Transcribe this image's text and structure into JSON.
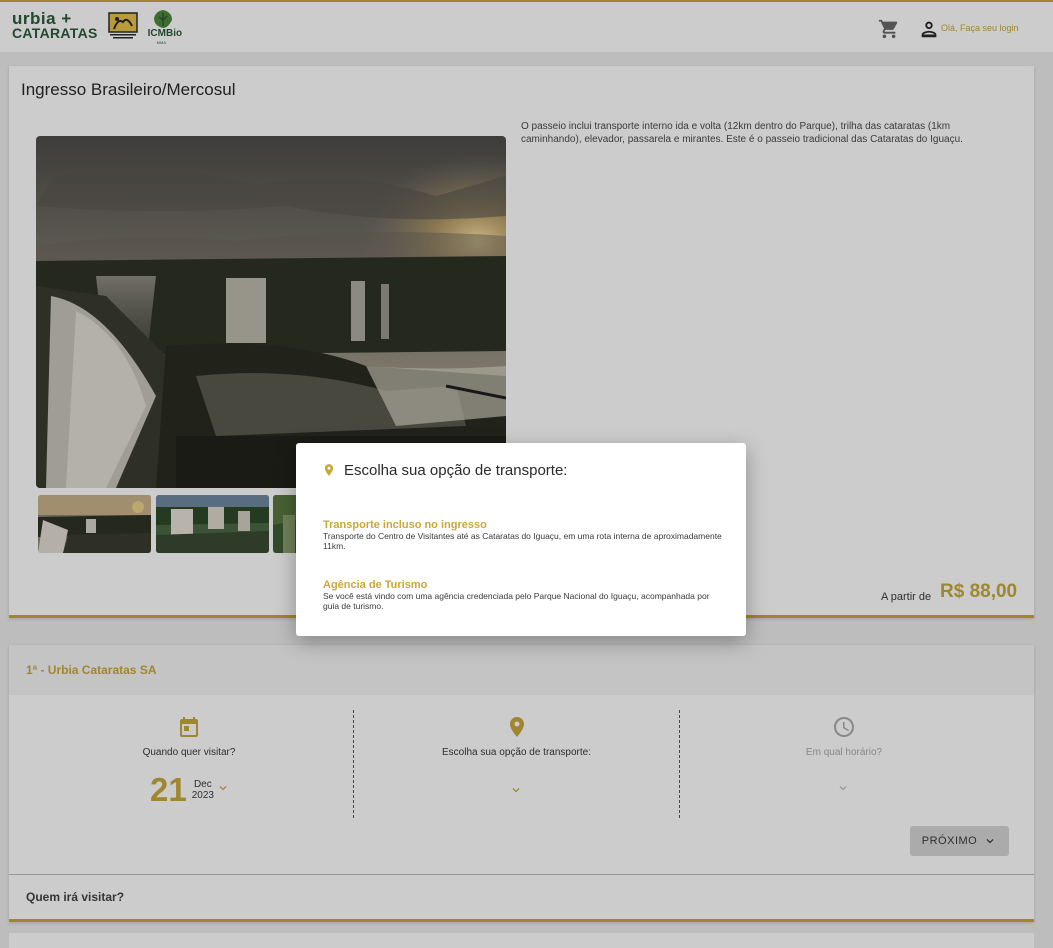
{
  "header": {
    "logo_line1": "urbia +",
    "logo_line2": "CATARATAS",
    "logo_icm": "ICMBio",
    "logo_mma": "MMA",
    "login_text": "Olá, Faça seu login"
  },
  "product": {
    "title": "Ingresso Brasileiro/Mercosul",
    "description": "O passeio inclui transporte interno ida e volta (12km dentro do Parque), trilha das cataratas (1km caminhando), elevador, passarela e mirantes. Este é o passeio tradicional das Cataratas do Iguaçu.",
    "price_prefix": "A partir de",
    "price": "R$ 88,00"
  },
  "booking": {
    "heading": "1ª - Urbia Cataratas SA",
    "date_label": "Quando quer visitar?",
    "day": "21",
    "month": "Dec",
    "year": "2023",
    "transport_label": "Escolha sua opção de transporte:",
    "time_label": "Em qual horário?",
    "next_button": "PRÓXIMO",
    "who_label": "Quem irá visitar?"
  },
  "modal": {
    "title": "Escolha sua opção de transporte:",
    "options": [
      {
        "title": "Transporte incluso no ingresso",
        "desc": "Transporte do Centro de Visitantes até as Cataratas do Iguaçu, em uma rota interna de aproximadamente 11km."
      },
      {
        "title": "Agência de Turismo",
        "desc": "Se você está vindo com uma agência credenciada pelo Parque Nacional do Iguaçu, acompanhada por guia de turismo."
      }
    ]
  },
  "colors": {
    "accent": "#c9a83a",
    "brand_green": "#2d5a3a"
  },
  "icons": [
    "cart-icon",
    "user-icon",
    "calendar-icon",
    "location-pin-icon",
    "clock-icon",
    "chevron-down-icon"
  ]
}
